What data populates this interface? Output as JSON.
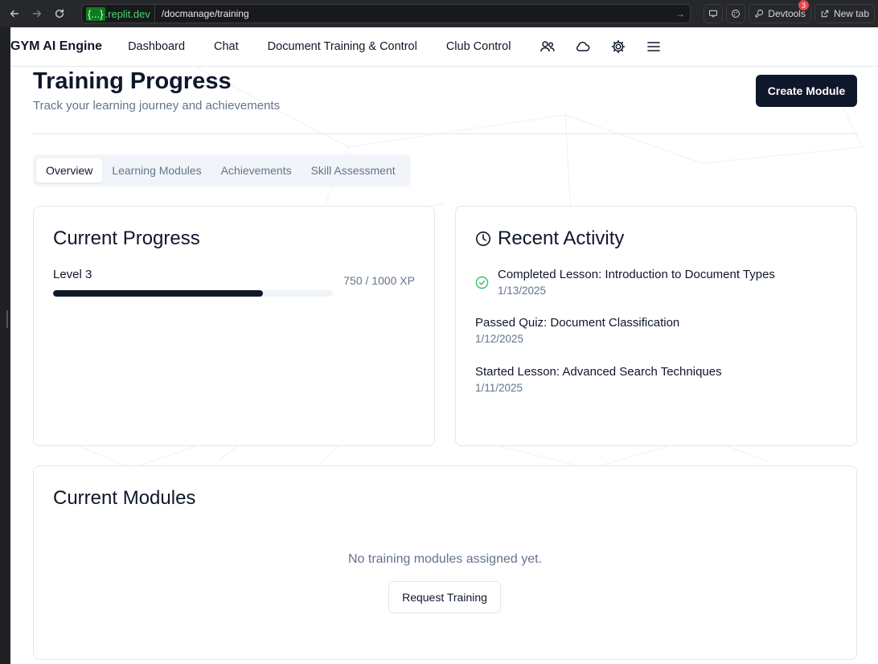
{
  "browser": {
    "domain_prefix": "{...}",
    "domain_suffix": ".replit.dev",
    "url_path": "/docmanage/training",
    "devtools_label": "Devtools",
    "devtools_badge": "3",
    "new_tab_label": "New tab"
  },
  "appbar": {
    "brand": "GYM AI Engine",
    "links": [
      "Dashboard",
      "Chat",
      "Document Training & Control",
      "Club Control"
    ],
    "icons": [
      "users-icon",
      "cloud-icon",
      "settings-icon",
      "menu-icon"
    ]
  },
  "header": {
    "title": "Training Progress",
    "subtitle": "Track your learning journey and achievements",
    "create_button": "Create Module"
  },
  "tabs": [
    {
      "label": "Overview",
      "active": true
    },
    {
      "label": "Learning Modules",
      "active": false
    },
    {
      "label": "Achievements",
      "active": false
    },
    {
      "label": "Skill Assessment",
      "active": false
    }
  ],
  "progress": {
    "title": "Current Progress",
    "level_label": "Level 3",
    "xp_text": "750 / 1000 XP",
    "fraction": 0.75
  },
  "activity": {
    "title": "Recent Activity",
    "items": [
      {
        "title": "Completed Lesson: Introduction to Document Types",
        "date": "1/13/2025",
        "completed": true
      },
      {
        "title": "Passed Quiz: Document Classification",
        "date": "1/12/2025",
        "completed": false
      },
      {
        "title": "Started Lesson: Advanced Search Techniques",
        "date": "1/11/2025",
        "completed": false
      }
    ]
  },
  "modules": {
    "title": "Current Modules",
    "empty_text": "No training modules assigned yet.",
    "request_button": "Request Training"
  },
  "colors": {
    "primary": "#0f172a",
    "muted": "#64748b",
    "success": "#22c55e",
    "domain_green": "#4ad36a"
  }
}
